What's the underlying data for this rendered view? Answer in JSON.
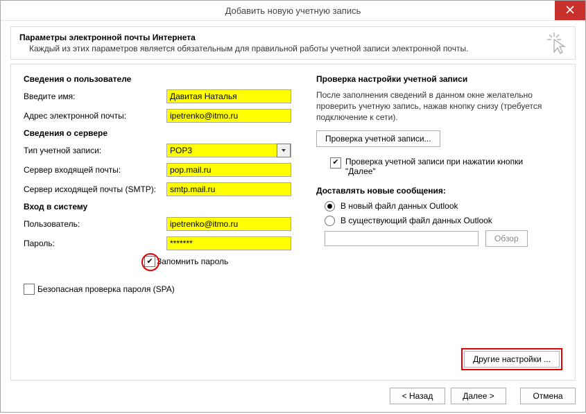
{
  "window": {
    "title": "Добавить новую учетную запись"
  },
  "header": {
    "title": "Параметры электронной почты Интернета",
    "sub": "Каждый из этих параметров является обязательным для правильной работы учетной записи электронной почты."
  },
  "left": {
    "section_user": "Сведения о пользователе",
    "name_label": "Введите имя:",
    "name_value": "Давитая Наталья",
    "email_label": "Адрес электронной почты:",
    "email_value": "ipetrenko@itmo.ru",
    "section_server": "Сведения о сервере",
    "acct_type_label": "Тип учетной записи:",
    "acct_type_value": "POP3",
    "incoming_label": "Сервер входящей почты:",
    "incoming_value": "pop.mail.ru",
    "outgoing_label": "Сервер исходящей почты (SMTP):",
    "outgoing_value": "smtp.mail.ru",
    "section_login": "Вход в систему",
    "user_label": "Пользователь:",
    "user_value": "ipetrenko@itmo.ru",
    "pass_label": "Пароль:",
    "pass_value": "*******",
    "remember_label": "Запомнить пароль",
    "spa_label": "Безопасная проверка пароля (SPA)"
  },
  "right": {
    "section_test": "Проверка настройки учетной записи",
    "test_desc": "После заполнения сведений в данном окне желательно проверить учетную запись, нажав кнопку снизу (требуется подключение к сети).",
    "test_btn": "Проверка учетной записи...",
    "test_on_next": "Проверка учетной записи при нажатии кнопки \"Далее\"",
    "section_delivery": "Доставлять новые сообщения:",
    "radio_new": "В новый файл данных Outlook",
    "radio_existing": "В существующий файл данных Outlook",
    "browse_btn": "Обзор",
    "other_settings": "Другие настройки ..."
  },
  "footer": {
    "back": "< Назад",
    "next": "Далее >",
    "cancel": "Отмена"
  }
}
